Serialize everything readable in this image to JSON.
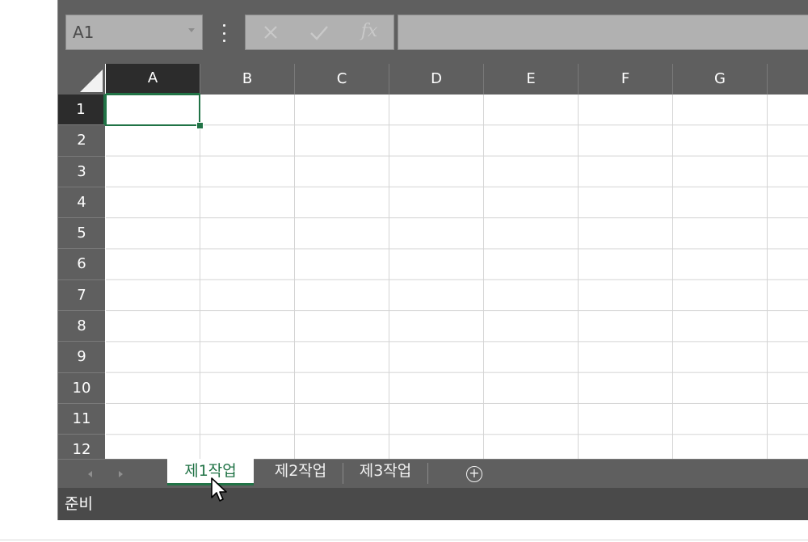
{
  "formula_bar": {
    "name_box_value": "A1",
    "fx_label": "fx",
    "formula_value": ""
  },
  "grid": {
    "columns": [
      "A",
      "B",
      "C",
      "D",
      "E",
      "F",
      "G"
    ],
    "rows": [
      "1",
      "2",
      "3",
      "4",
      "5",
      "6",
      "7",
      "8",
      "9",
      "10",
      "11",
      "12"
    ],
    "selected_cell": "A1"
  },
  "sheet_tabs": {
    "tabs": [
      "제1작업",
      "제2작업",
      "제3작업"
    ],
    "active_tab": "제1작업",
    "add_sheet_label": "+"
  },
  "status_bar": {
    "status_text": "준비"
  },
  "colors": {
    "accent": "#217346",
    "chrome": "#5f5f5f",
    "status_bar": "#4a4a4a"
  }
}
